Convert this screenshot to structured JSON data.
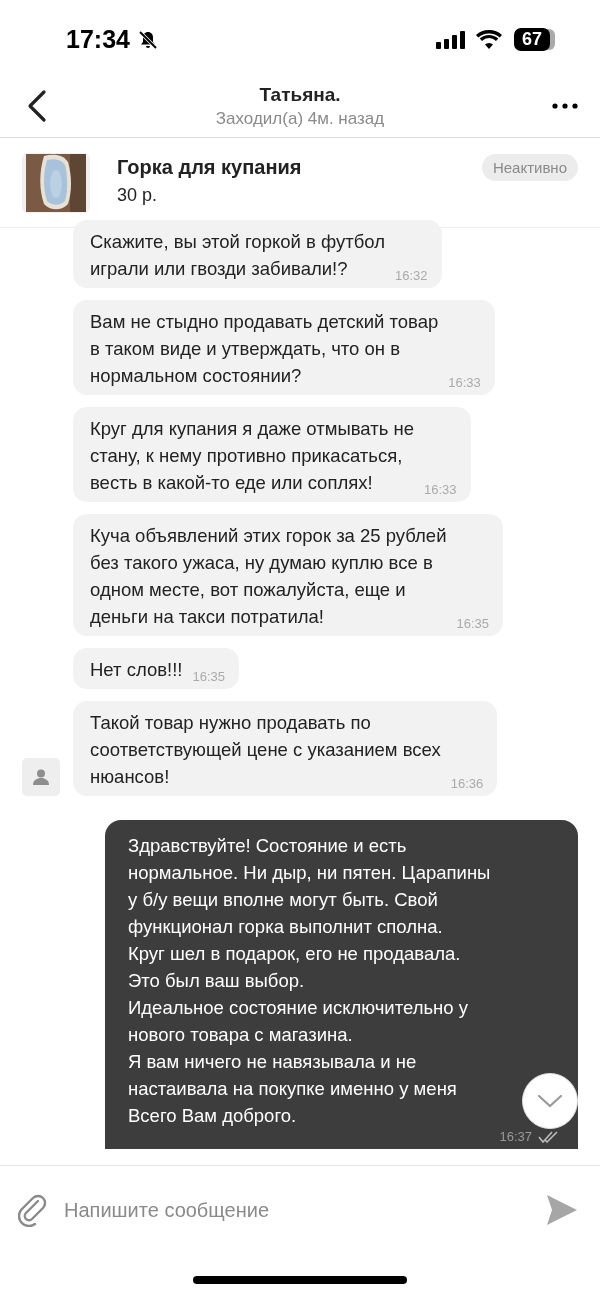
{
  "status_bar": {
    "time": "17:34",
    "battery": "67"
  },
  "header": {
    "title": "Татьяна.",
    "subtitle": "Заходил(а) 4м. назад"
  },
  "listing": {
    "title": "Горка для купания",
    "price": "30 р.",
    "status": "Неактивно"
  },
  "messages": [
    {
      "kind": "incoming",
      "text": "Скажите, вы этой горкой в футбол\nиграли или гвозди забивали!?",
      "time": "16:32",
      "avatar": false
    },
    {
      "kind": "incoming",
      "text": "Вам не стыдно продавать детский товар\nв таком виде и утверждать, что он в\nнормальном состоянии?",
      "time": "16:33",
      "avatar": false
    },
    {
      "kind": "incoming",
      "text": "Круг для купания я даже отмывать не\nстану, к нему противно прикасаться,\nвесть в какой-то еде или соплях!",
      "time": "16:33",
      "avatar": false
    },
    {
      "kind": "incoming",
      "text": "Куча объявлений этих горок за 25 рублей\nбез такого ужаса, ну думаю куплю все в\nодном месте, вот пожалуйста, еще и\nденьги на такси потратила!",
      "time": "16:35",
      "avatar": false
    },
    {
      "kind": "incoming",
      "text": "Нет слов!!!",
      "time": "16:35",
      "avatar": false
    },
    {
      "kind": "incoming",
      "text": "Такой товар нужно продавать по\nсоответствующей цене с указанием всех\nнюансов!",
      "time": "16:36",
      "avatar": true
    },
    {
      "kind": "outgoing",
      "text": "Здравствуйте! Состояние и есть\nнормальное. Ни дыр, ни пятен. Царапины\nу б/у вещи вполне могут быть. Свой\nфункционал горка выполнит сполна.\nКруг шел в подарок, его не продавала.\nЭто был ваш выбор.\nИдеальное состояние исключительно у\nнового товара с магазина.\nЯ вам ничего не навязывала и не\nнастаивала на покупке именно у меня\nВсего Вам доброго.",
      "time": "16:37",
      "read": true
    }
  ],
  "composer": {
    "placeholder": "Напишите сообщение"
  }
}
